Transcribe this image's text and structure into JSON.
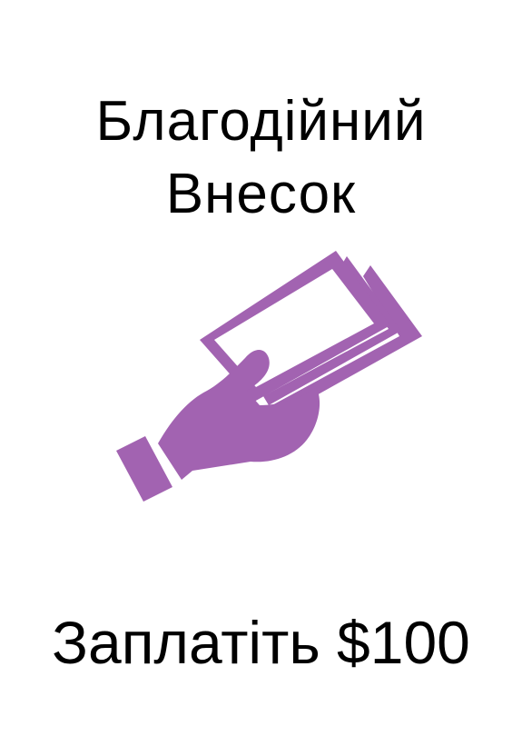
{
  "card": {
    "title_line1": "Благодійний",
    "title_line2": "Внесок",
    "footer_text": "Заплатіть $100"
  },
  "icon": {
    "name": "hand-giving-money-icon",
    "color": "#a263b1"
  }
}
